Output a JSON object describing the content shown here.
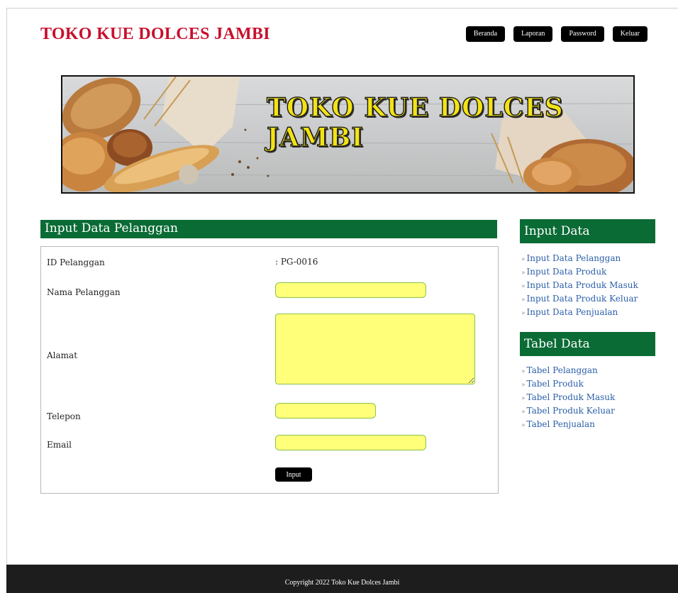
{
  "site": {
    "title": "TOKO KUE DOLCES JAMBI"
  },
  "nav": [
    {
      "label": "Beranda"
    },
    {
      "label": "Laporan"
    },
    {
      "label": "Password"
    },
    {
      "label": "Keluar"
    }
  ],
  "banner": {
    "title": "TOKO KUE DOLCES JAMBI"
  },
  "main": {
    "header": "Input Data Pelanggan",
    "form": {
      "id_label": "ID Pelanggan",
      "id_value": ": PG-0016",
      "nama_label": "Nama Pelanggan",
      "nama_value": "",
      "alamat_label": "Alamat",
      "alamat_value": "",
      "telepon_label": "Telepon",
      "telepon_value": "",
      "email_label": "Email",
      "email_value": "",
      "submit_label": "Input"
    }
  },
  "sidebar": {
    "input_header": "Input Data",
    "input_items": [
      "Input Data Pelanggan",
      "Input Data Produk",
      "Input Data Produk Masuk",
      "Input Data Produk Keluar",
      "Input Data Penjualan"
    ],
    "tabel_header": "Tabel Data",
    "tabel_items": [
      "Tabel Pelanggan",
      "Tabel Produk",
      "Tabel Produk Masuk",
      "Tabel Produk Keluar",
      "Tabel Penjualan"
    ],
    "bullet": "»"
  },
  "footer": {
    "text": "Copyright 2022 Toko Kue Dolces Jambi"
  },
  "colors": {
    "title_red": "#c8102e",
    "header_green": "#0a6b35",
    "field_yellow": "#ffff7a",
    "link_blue": "#2b5fa8",
    "footer_dark": "#1d1d1d"
  }
}
